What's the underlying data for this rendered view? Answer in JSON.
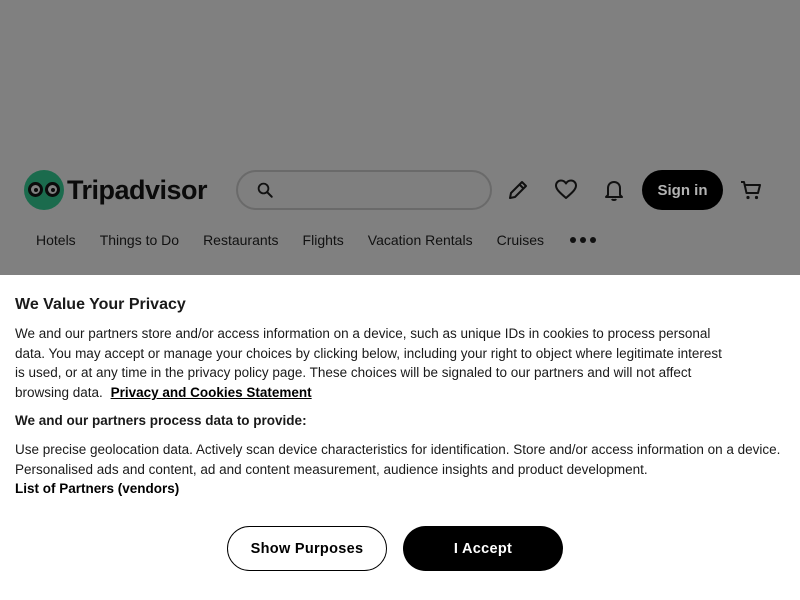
{
  "header": {
    "logo_text": "Tripadvisor",
    "search": {
      "placeholder": ""
    },
    "icons": [
      "pencil-icon",
      "heart-icon",
      "bell-icon",
      "cart-icon"
    ],
    "signin_label": "Sign in"
  },
  "nav": {
    "items": [
      "Hotels",
      "Things to Do",
      "Restaurants",
      "Flights",
      "Vacation Rentals",
      "Cruises"
    ],
    "more_icon": "more-dots-icon"
  },
  "consent": {
    "title": "We Value Your Privacy",
    "body": "We and our partners store and/or access information on a device, such as unique IDs in cookies to process personal data. You may accept or manage your choices by clicking below, including your right to object where legitimate interest is used, or at any time in the privacy policy page. These choices will be signaled to our partners and will not affect browsing data.",
    "policy_link": "Privacy and Cookies Statement",
    "subheading": "We and our partners process data to provide:",
    "purposes": "Use precise geolocation data. Actively scan device characteristics for identification. Store and/or access information on a device. Personalised ads and content, ad and content measurement, audience insights and product development.",
    "partners_link": "List of Partners (vendors)",
    "show_purposes_label": "Show Purposes",
    "accept_label": "I Accept"
  },
  "colors": {
    "overlay": "#808080",
    "logo_green": "#1b6b4d",
    "button_dark": "#000000",
    "modal_bg": "#ffffff"
  }
}
